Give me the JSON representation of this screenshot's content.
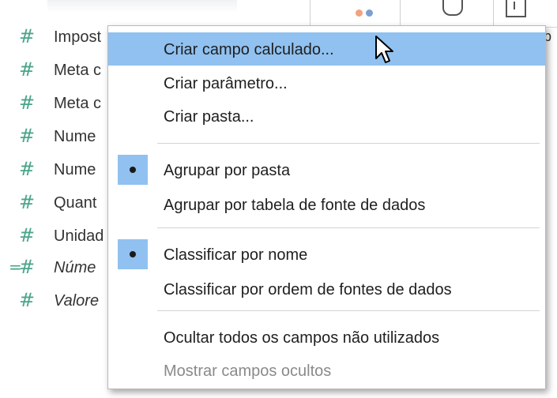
{
  "fields": [
    {
      "name": "Impost",
      "italic": false,
      "calc": false
    },
    {
      "name": "Meta c",
      "italic": false,
      "calc": false
    },
    {
      "name": "Meta c",
      "italic": false,
      "calc": false
    },
    {
      "name": "Nume",
      "italic": false,
      "calc": false
    },
    {
      "name": "Nume",
      "italic": false,
      "calc": false
    },
    {
      "name": "Quant",
      "italic": false,
      "calc": false
    },
    {
      "name": "Unidad",
      "italic": false,
      "calc": false
    },
    {
      "name": "Núme",
      "italic": true,
      "calc": true
    },
    {
      "name": "Valore",
      "italic": true,
      "calc": false
    }
  ],
  "toolbar": {
    "icons": [
      "color-dots-icon",
      "link-icon",
      "box-icon"
    ],
    "p_letter": "p"
  },
  "menu": {
    "items": [
      {
        "label": "Criar campo calculado...",
        "highlighted": true,
        "checked": false,
        "disabled": false
      },
      {
        "label": "Criar parâmetro...",
        "highlighted": false,
        "checked": false,
        "disabled": false
      },
      {
        "label": "Criar pasta...",
        "highlighted": false,
        "checked": false,
        "disabled": false
      },
      {
        "label": "Agrupar por pasta",
        "highlighted": false,
        "checked": true,
        "disabled": false
      },
      {
        "label": "Agrupar por tabela de fonte de dados",
        "highlighted": false,
        "checked": false,
        "disabled": false
      },
      {
        "label": "Classificar por nome",
        "highlighted": false,
        "checked": true,
        "disabled": false
      },
      {
        "label": "Classificar por ordem de fontes de dados",
        "highlighted": false,
        "checked": false,
        "disabled": false
      },
      {
        "label": "Ocultar todos os campos não utilizados",
        "highlighted": false,
        "checked": false,
        "disabled": false
      },
      {
        "label": "Mostrar campos ocultos",
        "highlighted": false,
        "checked": false,
        "disabled": true
      }
    ]
  },
  "colors": {
    "highlight": "#90c1f0",
    "measure_icon": "#4aa58a"
  }
}
